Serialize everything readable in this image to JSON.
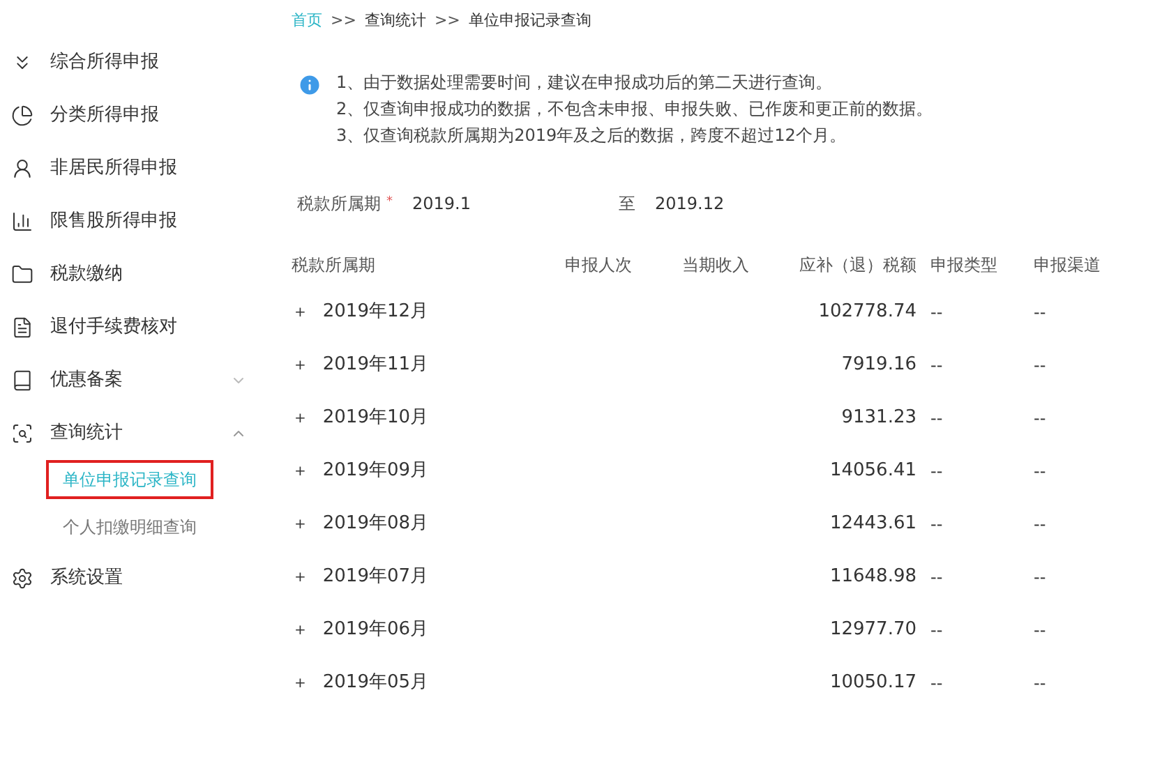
{
  "sidebar": {
    "items": [
      {
        "label": "综合所得申报"
      },
      {
        "label": "分类所得申报"
      },
      {
        "label": "非居民所得申报"
      },
      {
        "label": "限售股所得申报"
      },
      {
        "label": "税款缴纳"
      },
      {
        "label": "退付手续费核对"
      },
      {
        "label": "优惠备案",
        "expanded": false
      },
      {
        "label": "查询统计",
        "expanded": true,
        "children": [
          {
            "label": "单位申报记录查询",
            "selected": true
          },
          {
            "label": "个人扣缴明细查询",
            "selected": false
          }
        ]
      },
      {
        "label": "系统设置"
      }
    ]
  },
  "breadcrumb": [
    "首页",
    "查询统计",
    "单位申报记录查询"
  ],
  "breadcrumb_separator": ">>",
  "notes": [
    "1、由于数据处理需要时间，建议在申报成功后的第二天进行查询。",
    "2、仅查询申报成功的数据，不包含未申报、申报失败、已作废和更正前的数据。",
    "3、仅查询税款所属期为2019年及之后的数据，跨度不超过12个月。"
  ],
  "filter": {
    "label": "税款所属期",
    "required_mark": "*",
    "from": "2019.1",
    "to_label": "至",
    "to": "2019.12"
  },
  "table": {
    "columns": [
      "税款所属期",
      "申报人次",
      "当期收入",
      "应补（退）税额",
      "申报类型",
      "申报渠道"
    ],
    "rows": [
      {
        "expand": "+",
        "period": "2019年12月",
        "tax": "102778.74",
        "type": "--",
        "channel": "--"
      },
      {
        "expand": "+",
        "period": "2019年11月",
        "tax": "7919.16",
        "type": "--",
        "channel": "--"
      },
      {
        "expand": "+",
        "period": "2019年10月",
        "tax": "9131.23",
        "type": "--",
        "channel": "--"
      },
      {
        "expand": "+",
        "period": "2019年09月",
        "tax": "14056.41",
        "type": "--",
        "channel": "--"
      },
      {
        "expand": "+",
        "period": "2019年08月",
        "tax": "12443.61",
        "type": "--",
        "channel": "--"
      },
      {
        "expand": "+",
        "period": "2019年07月",
        "tax": "11648.98",
        "type": "--",
        "channel": "--"
      },
      {
        "expand": "+",
        "period": "2019年06月",
        "tax": "12977.70",
        "type": "--",
        "channel": "--"
      },
      {
        "expand": "+",
        "period": "2019年05月",
        "tax": "10050.17",
        "type": "--",
        "channel": "--"
      }
    ]
  }
}
